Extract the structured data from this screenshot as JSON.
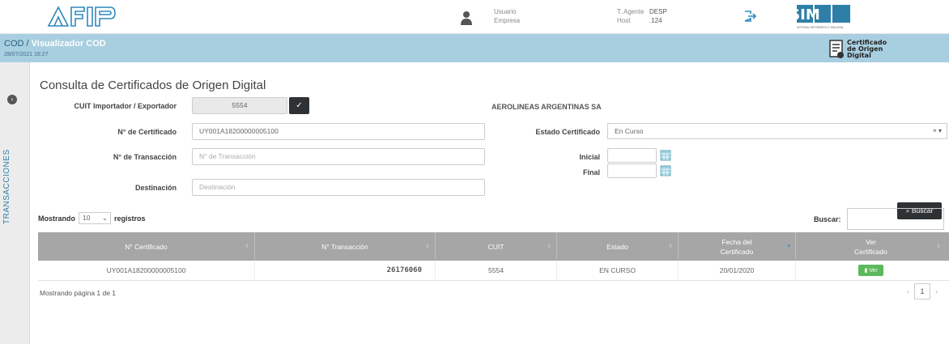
{
  "header": {
    "logo_text": "AFIP",
    "user_label": "Usuario",
    "company_label": "Empresa",
    "agent_label": "T. Agente",
    "agent_value": "DESP",
    "host_label": "Host",
    "host_value": ".124",
    "sim_logo": "SIM",
    "sim_subtitle": "SISTEMA INFORMÁTICO MALVINA"
  },
  "bluebar": {
    "crumb_root": "COD /",
    "crumb_current": "Visualizador COD",
    "datetime": "28/07/2021 16:27",
    "cert_line1": "Certificado",
    "cert_line2": "de Origen",
    "cert_line3": "Digital"
  },
  "sidebar": {
    "label": "TRANSACCIONES"
  },
  "form": {
    "title": "Consulta de Certificados de Origen Digital",
    "cuit_label": "CUIT Importador / Exportador",
    "cuit_value": "5554",
    "company_name": "AEROLINEAS ARGENTINAS SA",
    "cert_label": "N° de Certificado",
    "cert_value": "UY001A18200000005100",
    "estado_label": "Estado Certificado",
    "estado_value": "En Curso",
    "trans_label": "N° de Transacción",
    "trans_placeholder": "N° de Transacción",
    "inicial_label": "Inicial",
    "final_label": "Final",
    "dest_label": "Destinación",
    "dest_placeholder": "Destinación",
    "buscar_button": "Buscar"
  },
  "table_controls": {
    "mostrando": "Mostrando",
    "page_size": "10",
    "registros": "registros",
    "search_label": "Buscar:"
  },
  "table": {
    "columns": [
      "N° Certificado",
      "N° Transacción",
      "CUIT",
      "Estado",
      "Fecha del\nCertificado",
      "Ver\nCertificado"
    ],
    "rows": [
      {
        "certificado": "UY001A18200000005100",
        "transaccion": "26176060",
        "cuit": "5554",
        "estado": "EN CURSO",
        "fecha": "20/01/2020",
        "ver": "Ver"
      }
    ]
  },
  "pagination": {
    "info": "Mostrando página 1 de 1",
    "current": "1",
    "prev": "‹",
    "next": "›"
  }
}
